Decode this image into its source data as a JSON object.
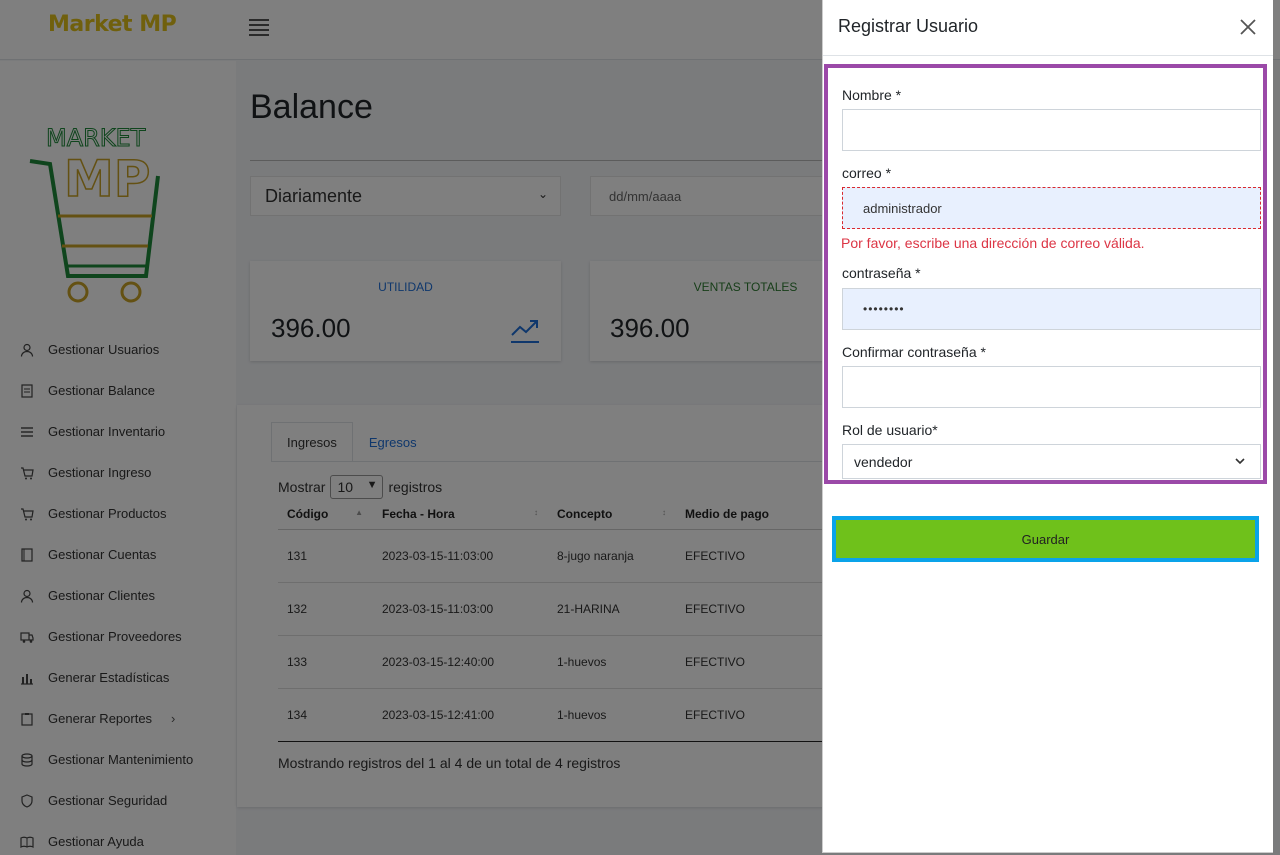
{
  "app": {
    "brand": "Market MP",
    "logo_text_top": "MARKET",
    "logo_text_main": "MP"
  },
  "sidebar": {
    "items": [
      {
        "label": "Gestionar Usuarios",
        "icon": "user-icon"
      },
      {
        "label": "Gestionar Balance",
        "icon": "document-icon"
      },
      {
        "label": "Gestionar Inventario",
        "icon": "list-icon"
      },
      {
        "label": "Gestionar Ingreso",
        "icon": "cart-icon"
      },
      {
        "label": "Gestionar Productos",
        "icon": "cart-icon"
      },
      {
        "label": "Gestionar Cuentas",
        "icon": "book-icon"
      },
      {
        "label": "Gestionar Clientes",
        "icon": "user-icon"
      },
      {
        "label": "Gestionar Proveedores",
        "icon": "truck-icon"
      },
      {
        "label": "Generar Estadísticas",
        "icon": "bar-chart-icon"
      },
      {
        "label": "Generar Reportes",
        "icon": "clipboard-icon",
        "has_submenu": true
      },
      {
        "label": "Gestionar Mantenimiento",
        "icon": "database-icon"
      },
      {
        "label": "Gestionar Seguridad",
        "icon": "shield-icon"
      },
      {
        "label": "Gestionar Ayuda",
        "icon": "open-book-icon"
      }
    ]
  },
  "main": {
    "title": "Balance",
    "period": "Diariamente",
    "date_placeholder": "dd/mm/aaaa",
    "cards": [
      {
        "label": "UTILIDAD",
        "value": "396.00",
        "label_color": "#1e6fd9",
        "icon": "trend-up-icon"
      },
      {
        "label": "VENTAS TOTALES",
        "value": "396.00",
        "label_color": "#2e7d32"
      }
    ],
    "tabs": [
      "Ingresos",
      "Egresos"
    ],
    "show_prefix": "Mostrar",
    "show_value": "10",
    "show_suffix": "registros",
    "columns": [
      "Código",
      "Fecha - Hora",
      "Concepto",
      "Medio de pago"
    ],
    "rows": [
      [
        "131",
        "2023-03-15-11:03:00",
        "8-jugo naranja",
        "EFECTIVO"
      ],
      [
        "132",
        "2023-03-15-11:03:00",
        "21-HARINA",
        "EFECTIVO"
      ],
      [
        "133",
        "2023-03-15-12:40:00",
        "1-huevos",
        "EFECTIVO"
      ],
      [
        "134",
        "2023-03-15-12:41:00",
        "1-huevos",
        "EFECTIVO"
      ]
    ],
    "info": "Mostrando registros del 1 al 4 de un total de 4 registros"
  },
  "panel": {
    "title": "Registrar Usuario",
    "fields": {
      "nombre_label": "Nombre *",
      "nombre_value": "",
      "correo_label": "correo *",
      "correo_value": "administrador",
      "correo_error": "Por favor, escribe una dirección de correo válida.",
      "password_label": "contraseña *",
      "password_value": "••••••••",
      "confirm_label": "Confirmar contraseña *",
      "confirm_value": "",
      "rol_label": "Rol de usuario*",
      "rol_value": "vendedor"
    },
    "save_label": "Guardar"
  },
  "colors": {
    "form_highlight": "#9b49a8",
    "save_highlight": "#0aa3e9",
    "save_button": "#6fc11b",
    "error": "#dc3545",
    "brand": "#e0c01a"
  }
}
